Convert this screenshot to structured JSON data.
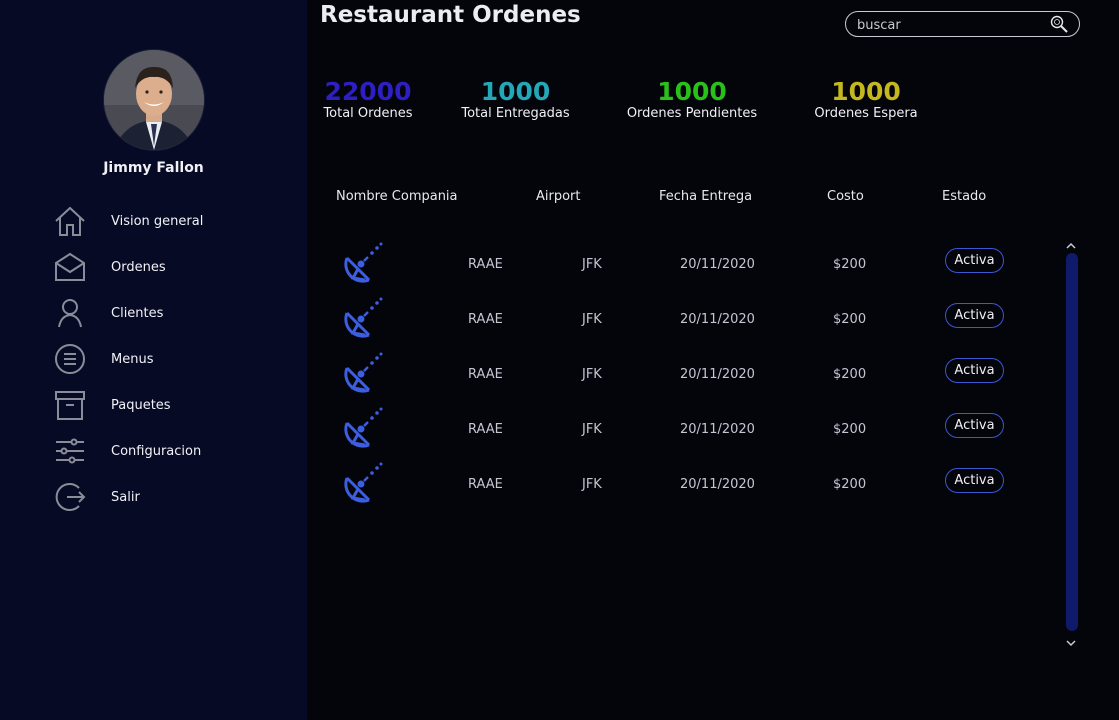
{
  "user": {
    "name": "Jimmy Fallon"
  },
  "nav": [
    {
      "label": "Vision general",
      "icon": "home-icon"
    },
    {
      "label": "Ordenes",
      "icon": "mail-icon"
    },
    {
      "label": "Clientes",
      "icon": "user-icon"
    },
    {
      "label": "Menus",
      "icon": "menu-circle-icon"
    },
    {
      "label": "Paquetes",
      "icon": "archive-box-icon"
    },
    {
      "label": "Configuracion",
      "icon": "sliders-icon"
    },
    {
      "label": "Salir",
      "icon": "logout-icon"
    }
  ],
  "header": {
    "title": "Restaurant Ordenes"
  },
  "search": {
    "placeholder": "buscar",
    "icon": "search-icon"
  },
  "stats": [
    {
      "value": "22000",
      "label": "Total Ordenes",
      "color": "#2d1fc4"
    },
    {
      "value": "1000",
      "label": "Total Entregadas",
      "color": "#22a8b6"
    },
    {
      "value": "1000",
      "label": "Ordenes Pendientes",
      "color": "#28c019"
    },
    {
      "value": "1000",
      "label": "Ordenes Espera",
      "color": "#c4b81c"
    }
  ],
  "table": {
    "columns": [
      "Nombre Compania",
      "Airport",
      "Fecha Entrega",
      "Costo",
      "Estado"
    ],
    "rows": [
      {
        "icon": "satellite-dish-icon",
        "company": "RAAE",
        "airport": "JFK",
        "date": "20/11/2020",
        "cost": "$200",
        "status": "Activa"
      },
      {
        "icon": "satellite-dish-icon",
        "company": "RAAE",
        "airport": "JFK",
        "date": "20/11/2020",
        "cost": "$200",
        "status": "Activa"
      },
      {
        "icon": "satellite-dish-icon",
        "company": "RAAE",
        "airport": "JFK",
        "date": "20/11/2020",
        "cost": "$200",
        "status": "Activa"
      },
      {
        "icon": "satellite-dish-icon",
        "company": "RAAE",
        "airport": "JFK",
        "date": "20/11/2020",
        "cost": "$200",
        "status": "Activa"
      },
      {
        "icon": "satellite-dish-icon",
        "company": "RAAE",
        "airport": "JFK",
        "date": "20/11/2020",
        "cost": "$200",
        "status": "Activa"
      }
    ]
  },
  "colors": {
    "sidebar": "#060a24",
    "background": "#04040b",
    "accent": "#3b57d1",
    "scrollbar": "#101a6b"
  }
}
